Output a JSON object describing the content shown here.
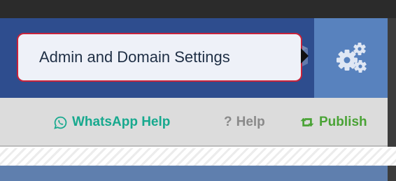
{
  "tooltip": {
    "text": "Admin and Domain Settings"
  },
  "icons": {
    "settings": "gears-icon",
    "whatsapp": "whatsapp-icon",
    "help": "question-icon",
    "publish": "retweet-icon"
  },
  "toolbar": {
    "whatsapp_label": "WhatsApp Help",
    "help_label": "Help",
    "publish_label": "Publish"
  },
  "colors": {
    "nav_bg": "#2e4d8e",
    "settings_button_bg": "#5882be",
    "tooltip_border": "#c8223a",
    "whatsapp": "#17a98e",
    "help": "#8a8a8a",
    "publish": "#4aa336"
  }
}
